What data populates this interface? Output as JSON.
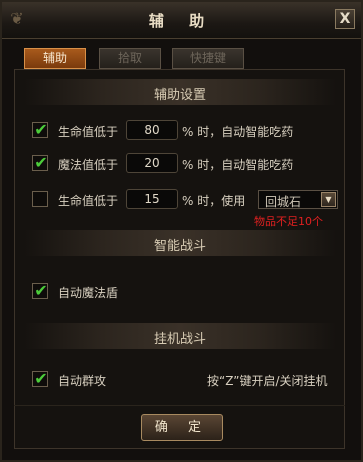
{
  "window": {
    "title": "辅 助",
    "close_label": "X"
  },
  "tabs": [
    {
      "label": "辅助",
      "active": true
    },
    {
      "label": "拾取",
      "active": false
    },
    {
      "label": "快捷键",
      "active": false
    }
  ],
  "sections": {
    "assist_settings": "辅助设置",
    "smart_combat": "智能战斗",
    "idle_combat": "挂机战斗"
  },
  "hp_potion": {
    "checked": true,
    "label": "生命值低于",
    "value": "80",
    "suffix": "% 时，自动智能吃药"
  },
  "mp_potion": {
    "checked": true,
    "label": "魔法值低于",
    "value": "20",
    "suffix": "% 时，自动智能吃药"
  },
  "hp_item": {
    "checked": false,
    "label": "生命值低于",
    "value": "15",
    "suffix": "% 时，使用",
    "item": "回城石",
    "warning": "物品不足10个"
  },
  "auto_shield": {
    "checked": true,
    "label": "自动魔法盾"
  },
  "auto_aoe": {
    "checked": true,
    "label": "自动群攻"
  },
  "hotkey_hint": "按“Z”键开启/关闭挂机",
  "confirm_label": "确 定",
  "colors": {
    "accent": "#a85a1c",
    "check": "#4ccc3a",
    "warning": "#e02020"
  }
}
